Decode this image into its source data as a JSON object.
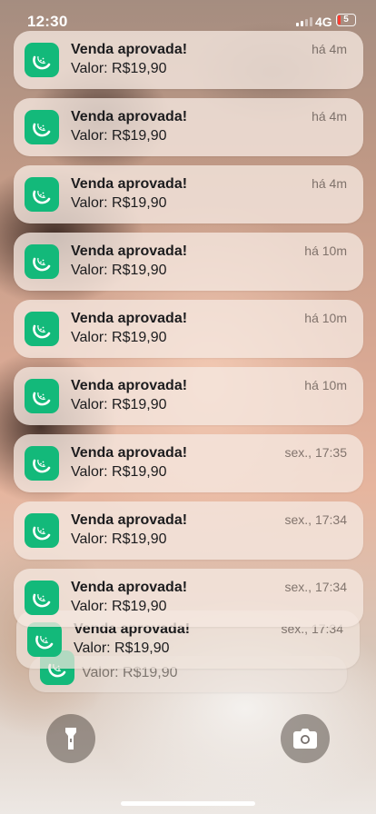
{
  "status_bar": {
    "time": "12:30",
    "network": "4G",
    "battery": "5"
  },
  "app": {
    "name": "melon-app-icon",
    "color": "#13b97a"
  },
  "notifications": [
    {
      "title": "Venda aprovada!",
      "body": "Valor: R$19,90",
      "time": "há 4m"
    },
    {
      "title": "Venda aprovada!",
      "body": "Valor: R$19,90",
      "time": "há 4m"
    },
    {
      "title": "Venda aprovada!",
      "body": "Valor: R$19,90",
      "time": "há 4m"
    },
    {
      "title": "Venda aprovada!",
      "body": "Valor: R$19,90",
      "time": "há 10m"
    },
    {
      "title": "Venda aprovada!",
      "body": "Valor: R$19,90",
      "time": "há 10m"
    },
    {
      "title": "Venda aprovada!",
      "body": "Valor: R$19,90",
      "time": "há 10m"
    },
    {
      "title": "Venda aprovada!",
      "body": "Valor: R$19,90",
      "time": "sex., 17:35"
    },
    {
      "title": "Venda aprovada!",
      "body": "Valor: R$19,90",
      "time": "sex., 17:34"
    },
    {
      "title": "Venda aprovada!",
      "body": "Valor: R$19,90",
      "time": "sex., 17:34"
    }
  ],
  "stack_behind": [
    {
      "title": "Venda aprovada!",
      "body": "Valor: R$19,90",
      "time": "sex., 17:34"
    },
    {
      "body": "Valor: R$19,90"
    }
  ],
  "bottom": {
    "left_icon": "flashlight-icon",
    "right_icon": "camera-icon"
  }
}
